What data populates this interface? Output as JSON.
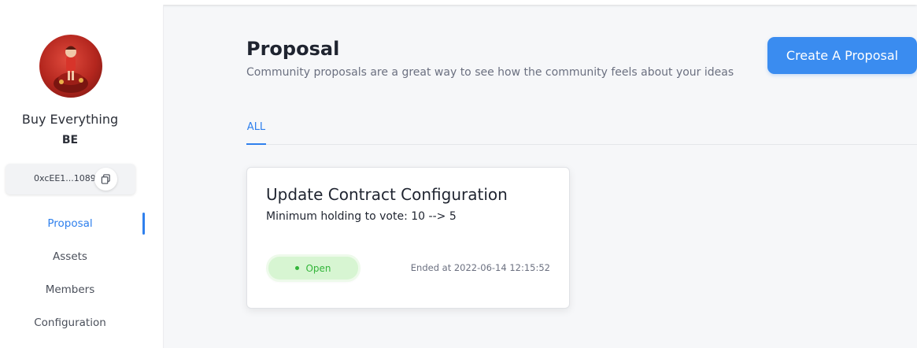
{
  "sidebar": {
    "org_name": "Buy Everything",
    "org_symbol": "BE",
    "address": "0xcEE1...1089",
    "nav": [
      {
        "label": "Proposal",
        "active": true
      },
      {
        "label": "Assets",
        "active": false
      },
      {
        "label": "Members",
        "active": false
      },
      {
        "label": "Configuration",
        "active": false
      }
    ]
  },
  "main": {
    "title": "Proposal",
    "subtitle": "Community proposals are a great way to see how the community feels about your ideas",
    "create_button": "Create A Proposal",
    "tabs": [
      {
        "label": "ALL",
        "active": true
      }
    ],
    "proposals": [
      {
        "title": "Update Contract Configuration",
        "description": "Minimum holding to vote: 10 --> 5",
        "status": "Open",
        "ended": "Ended at 2022-06-14 12:15:52"
      }
    ]
  },
  "colors": {
    "accent": "#3a8cf0",
    "active_link": "#2f80ed",
    "status_open": "#33b53a",
    "status_bg": "#d7f5d2"
  },
  "icons": {
    "copy": "copy-icon"
  }
}
